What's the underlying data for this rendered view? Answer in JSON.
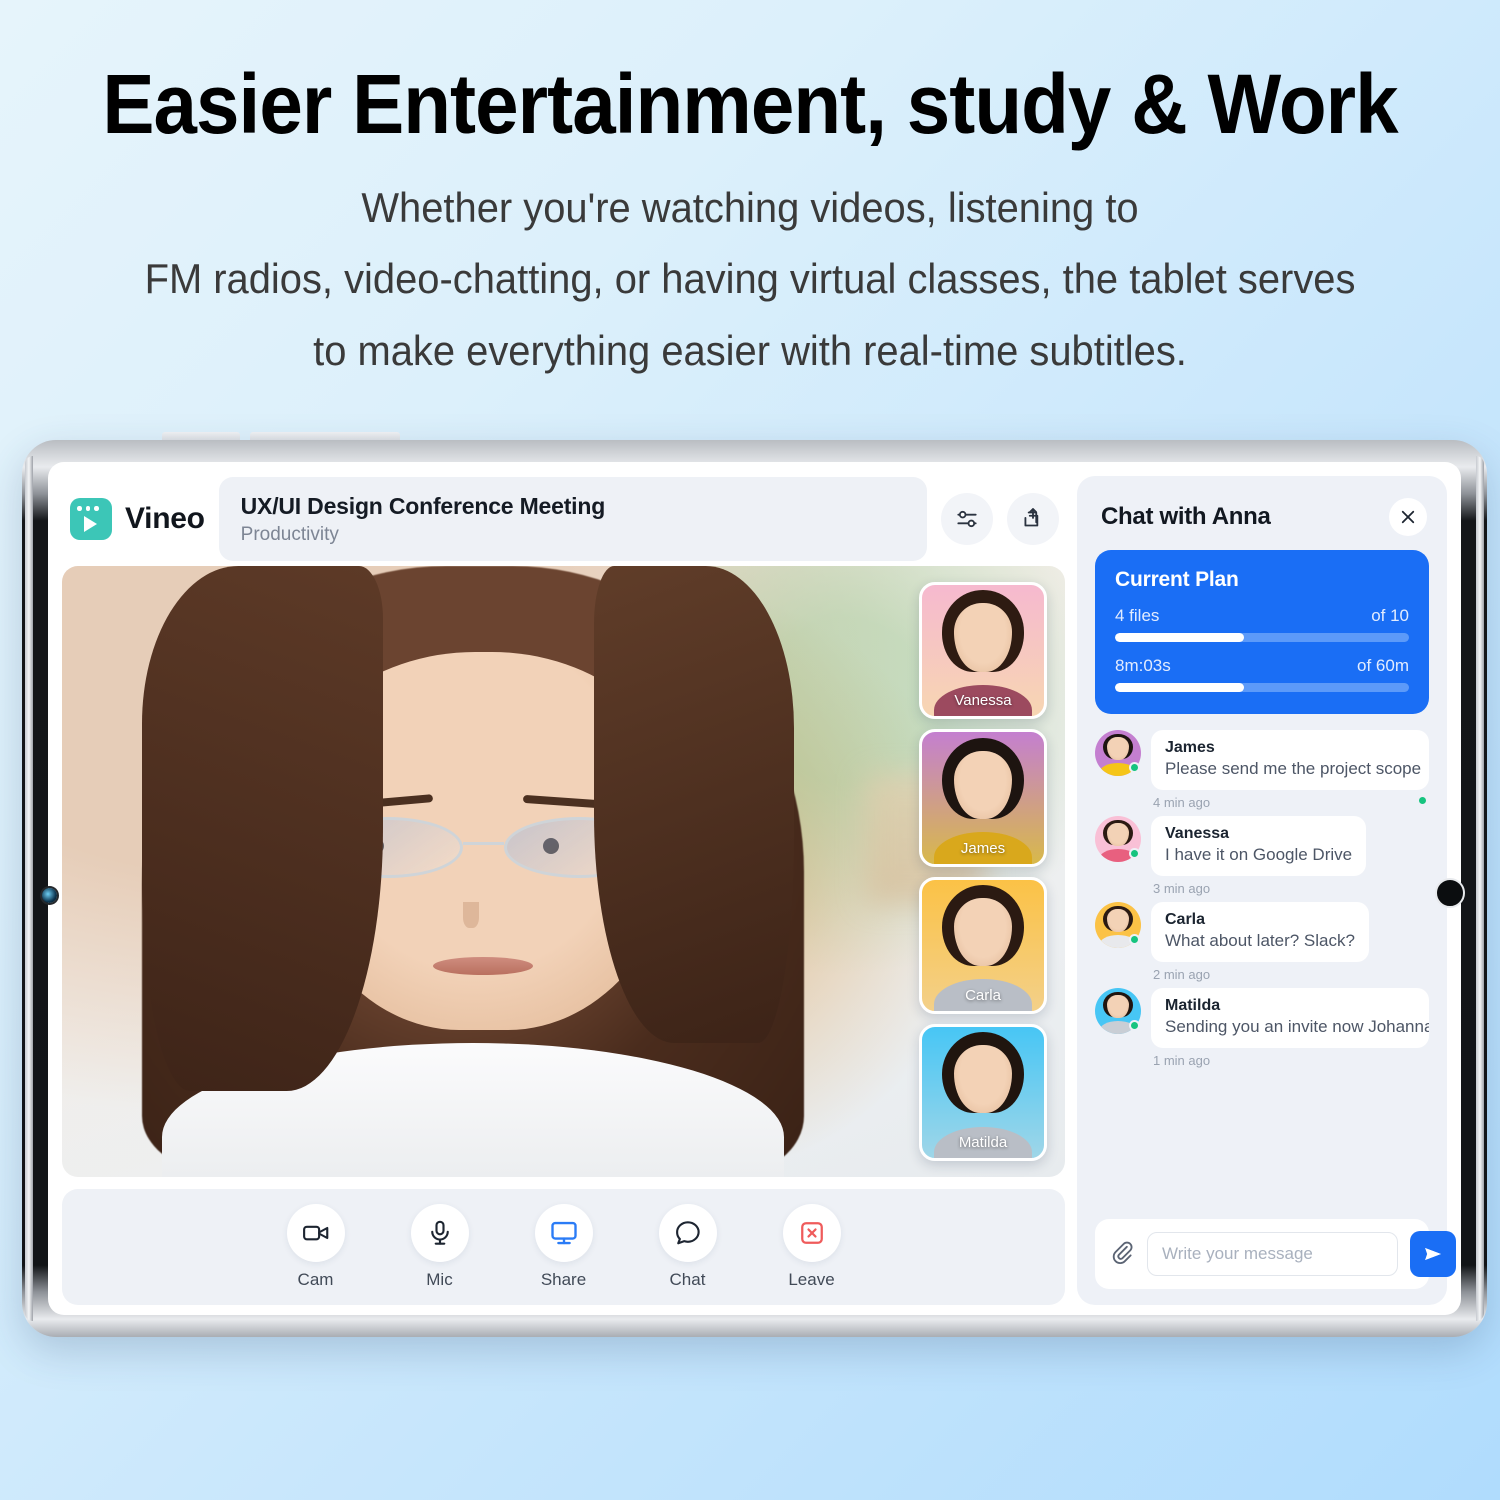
{
  "promo": {
    "headline": "Easier Entertainment, study & Work",
    "subtitle_lines": [
      "Whether you're watching videos, listening to",
      "FM radios, video-chatting, or having virtual classes, the tablet serves",
      "to make everything easier with real-time subtitles."
    ]
  },
  "colors": {
    "accent_blue": "#1a6ef5",
    "brand_teal": "#3cc6b7",
    "panel_bg": "#eef1f7",
    "online_green": "#16c47f",
    "leave_red": "#ef5b5b"
  },
  "app": {
    "brand_name": "Vineo",
    "brand_logo_icon": "video-play-logo-icon",
    "meeting": {
      "title": "UX/UI Design Conference Meeting",
      "category": "Productivity"
    },
    "header_actions": [
      {
        "name": "settings-sliders-icon",
        "label": "Settings"
      },
      {
        "name": "share-upload-icon",
        "label": "Share"
      }
    ]
  },
  "participants": [
    {
      "name": "Vanessa",
      "bg": "#f6b9cf",
      "bg2": "#f7d6b2",
      "body": "#9c4a5f",
      "hair": "#2e1b12"
    },
    {
      "name": "James",
      "bg": "#c47fd0",
      "bg2": "#d8b94a",
      "body": "#d9a81c",
      "hair": "#1d1410"
    },
    {
      "name": "Carla",
      "bg": "#fbc246",
      "bg2": "#f3d089",
      "body": "#b9bec6",
      "hair": "#2b1a12"
    },
    {
      "name": "Matilda",
      "bg": "#47c6f5",
      "bg2": "#9fd6e8",
      "body": "#b9bec6",
      "hair": "#20150f"
    }
  ],
  "controls": [
    {
      "label": "Cam",
      "icon": "camera-icon"
    },
    {
      "label": "Mic",
      "icon": "microphone-icon"
    },
    {
      "label": "Share",
      "icon": "screen-share-icon"
    },
    {
      "label": "Chat",
      "icon": "chat-bubble-icon"
    },
    {
      "label": "Leave",
      "icon": "leave-call-icon"
    }
  ],
  "chat": {
    "title": "Chat with Anna",
    "close_icon": "close-icon",
    "plan": {
      "title": "Current Plan",
      "rows": [
        {
          "used": "4 files",
          "total": "of 10",
          "percent": 44
        },
        {
          "used": "8m:03s",
          "total": "of 60m",
          "percent": 44
        }
      ]
    },
    "messages": [
      {
        "author": "James",
        "text": "Please send me the project scope",
        "time": "4 min ago",
        "avatar_bg": "#c47fd0",
        "avatar_body": "#f5c518",
        "hair": "#1d1410"
      },
      {
        "author": "Vanessa",
        "text": "I have it on Google Drive",
        "time": "3 min ago",
        "avatar_bg": "#f9c0d6",
        "avatar_body": "#e8607f",
        "hair": "#2b1a12"
      },
      {
        "author": "Carla",
        "text": "What about later? Slack?",
        "time": "2 min ago",
        "avatar_bg": "#fbc246",
        "avatar_body": "#e8e9ec",
        "hair": "#2b1a12"
      },
      {
        "author": "Matilda",
        "text": "Sending you an invite now Johanna!!",
        "time": "1 min ago",
        "avatar_bg": "#47c6f5",
        "avatar_body": "#c9ced5",
        "hair": "#20150f"
      }
    ],
    "composer": {
      "attach_icon": "paperclip-icon",
      "placeholder": "Write your message",
      "value": "",
      "send_icon": "send-icon"
    }
  }
}
